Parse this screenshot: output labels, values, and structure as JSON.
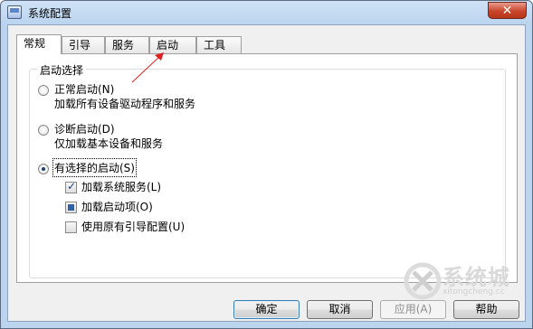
{
  "window": {
    "title": "系统配置",
    "close_glyph": "✕"
  },
  "tabs": [
    {
      "label": "常规",
      "active": true
    },
    {
      "label": "引导",
      "active": false
    },
    {
      "label": "服务",
      "active": false
    },
    {
      "label": "启动",
      "active": false
    },
    {
      "label": "工具",
      "active": false
    }
  ],
  "startup": {
    "group_label": "启动选择",
    "normal": {
      "label": "正常启动(N)",
      "desc": "加载所有设备驱动程序和服务",
      "selected": false
    },
    "diagnostic": {
      "label": "诊断启动(D)",
      "desc": "仅加载基本设备和服务",
      "selected": false
    },
    "selective": {
      "label": "有选择的启动(S)",
      "selected": true
    },
    "options": [
      {
        "label": "加载系统服务(L)",
        "state": "checked"
      },
      {
        "label": "加载启动项(O)",
        "state": "mixed"
      },
      {
        "label": "使用原有引导配置(U)",
        "state": "unchecked"
      }
    ]
  },
  "buttons": {
    "ok": "确定",
    "cancel": "取消",
    "apply": "应用(A)",
    "help": "帮助"
  },
  "watermark": {
    "text": "系统城",
    "sub": "xitongcheng.cc"
  },
  "colors": {
    "arrow": "#e02020",
    "close": "#c9452c"
  }
}
